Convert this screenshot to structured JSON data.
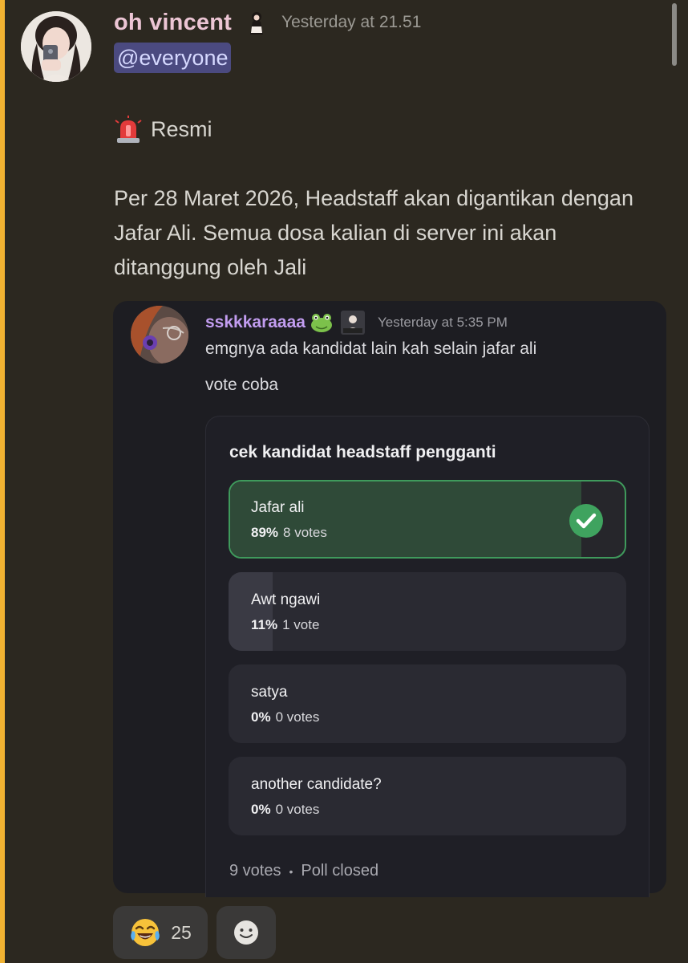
{
  "message": {
    "author": "oh vincent",
    "author_color": "#ecc5d4",
    "timestamp": "Yesterday at 21.51",
    "mention": "@everyone",
    "line1_emoji": "rotating-light-icon",
    "line1_text": "Resmi",
    "paragraph": "Per 28 Maret 2026, Headstaff akan digantikan dengan Jafar Ali. Semua dosa kalian di server ini akan ditanggung oleh Jali",
    "mention_bar_color": "#f0b232"
  },
  "forwarded": {
    "author": "sskkkaraaaa",
    "author_color": "#c29df0",
    "timestamp": "Yesterday at 5:35 PM",
    "text_line1": "emgnya ada kandidat lain kah selain jafar ali",
    "text_line2": "vote coba"
  },
  "poll": {
    "question": "cek kandidat headstaff pengganti",
    "options": [
      {
        "label": "Jafar ali",
        "percent_text": "89%",
        "votes_text": "8 votes",
        "fraction": 0.89,
        "winner": true
      },
      {
        "label": "Awt ngawi",
        "percent_text": "11%",
        "votes_text": "1 vote",
        "fraction": 0.11,
        "winner": false
      },
      {
        "label": "satya",
        "percent_text": "0%",
        "votes_text": "0 votes",
        "fraction": 0,
        "winner": false
      },
      {
        "label": "another candidate?",
        "percent_text": "0%",
        "votes_text": "0 votes",
        "fraction": 0,
        "winner": false
      }
    ],
    "total_votes": "9 votes",
    "separator": "•",
    "status": "Poll closed",
    "winner_color": "#3f9a5c"
  },
  "reactions": {
    "emoji": "joy-icon",
    "count": "25",
    "add_icon": "add-reaction-smile-icon"
  }
}
